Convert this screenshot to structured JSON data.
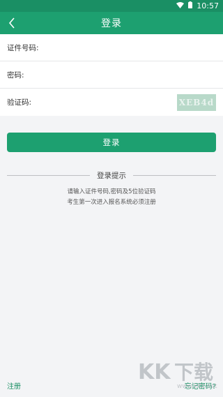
{
  "status_bar": {
    "time": "10:57",
    "wifi_icon": "wifi-icon",
    "battery_icon": "battery-icon"
  },
  "app_bar": {
    "title": "登录",
    "back_icon": "chevron-left-icon"
  },
  "form": {
    "id_label": "证件号码:",
    "password_label": "密码:",
    "captcha_label": "验证码:",
    "captcha_code": "XEB4d"
  },
  "login_button": "登录",
  "hint": {
    "title": "登录提示",
    "line1": "请输入证件号码,密码及5位验证码",
    "line2": "考生第一次进入报名系统必须注册"
  },
  "footer": {
    "register": "注册",
    "forgot": "忘记密码?"
  },
  "watermark": {
    "text": "KK下载",
    "url": "www.kkx.net"
  },
  "colors": {
    "primary": "#1da070",
    "status_bar": "#1a8f64",
    "captcha_bg": "#b8d9c9",
    "background": "#f3f4f6"
  }
}
